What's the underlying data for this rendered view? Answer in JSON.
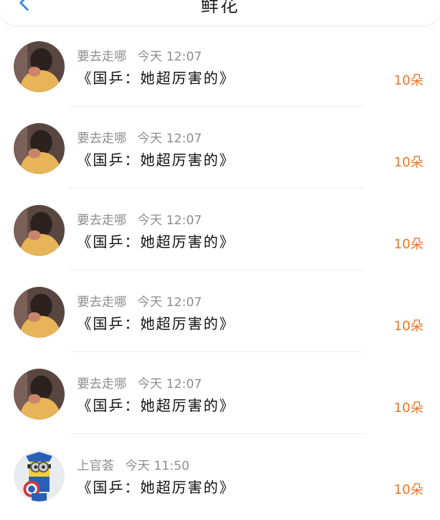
{
  "header": {
    "title": "鲜花",
    "back_icon": "chevron-left-icon",
    "accent_color": "#2e8ae6"
  },
  "items": [
    {
      "username": "要去走哪",
      "time": "今天 12:07",
      "message": "《国乒：她超厉害的》",
      "gift": "10朵",
      "avatar": "child-photo-avatar"
    },
    {
      "username": "要去走哪",
      "time": "今天 12:07",
      "message": "《国乒：她超厉害的》",
      "gift": "10朵",
      "avatar": "child-photo-avatar"
    },
    {
      "username": "要去走哪",
      "time": "今天 12:07",
      "message": "《国乒：她超厉害的》",
      "gift": "10朵",
      "avatar": "child-photo-avatar"
    },
    {
      "username": "要去走哪",
      "time": "今天 12:07",
      "message": "《国乒：她超厉害的》",
      "gift": "10朵",
      "avatar": "child-photo-avatar"
    },
    {
      "username": "要去走哪",
      "time": "今天 12:07",
      "message": "《国乒：她超厉害的》",
      "gift": "10朵",
      "avatar": "child-photo-avatar"
    },
    {
      "username": "上官荟",
      "time": "今天 11:50",
      "message": "《国乒：她超厉害的》",
      "gift": "10朵",
      "avatar": "minion-captain-avatar"
    }
  ],
  "colors": {
    "gift": "#e8782a",
    "meta": "#8f8f8f"
  }
}
